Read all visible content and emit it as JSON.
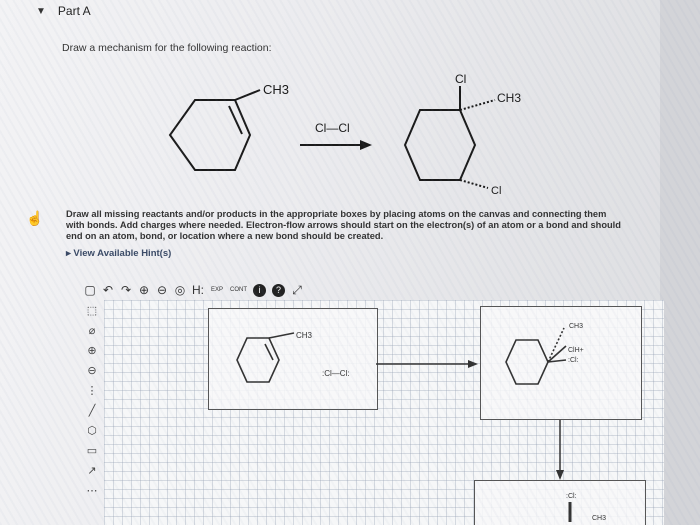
{
  "part": {
    "label": "Part A"
  },
  "question": {
    "prompt": "Draw a mechanism for the following reaction:",
    "reaction": {
      "reactant_label": "CH3",
      "reagent": "Cl—Cl",
      "product_top": "Cl",
      "product_methyl": "CH3",
      "product_bottom": "Cl"
    }
  },
  "instructions": "Draw all missing reactants and/or products in the appropriate boxes by placing atoms on the canvas and connecting them with bonds. Add charges where needed. Electron-flow arrows should start on the electron(s) of an atom or a bond and should end on an atom, bond, or location where a new bond should be created.",
  "hints_link": "View Available Hint(s)",
  "toolbar": {
    "h_label": "H:",
    "exp_label": "EXP",
    "cont_label": "CONT",
    "help_label": "?"
  },
  "canvas": {
    "box1": {
      "methyl": "CH3",
      "reagent": ":Cl—Cl:"
    },
    "box2": {
      "methyl": "CH3",
      "chloronium": "ClH+",
      "chloride": ":Cl:"
    },
    "box3": {
      "chloride": ":Cl:",
      "methyl": "CH3"
    }
  }
}
